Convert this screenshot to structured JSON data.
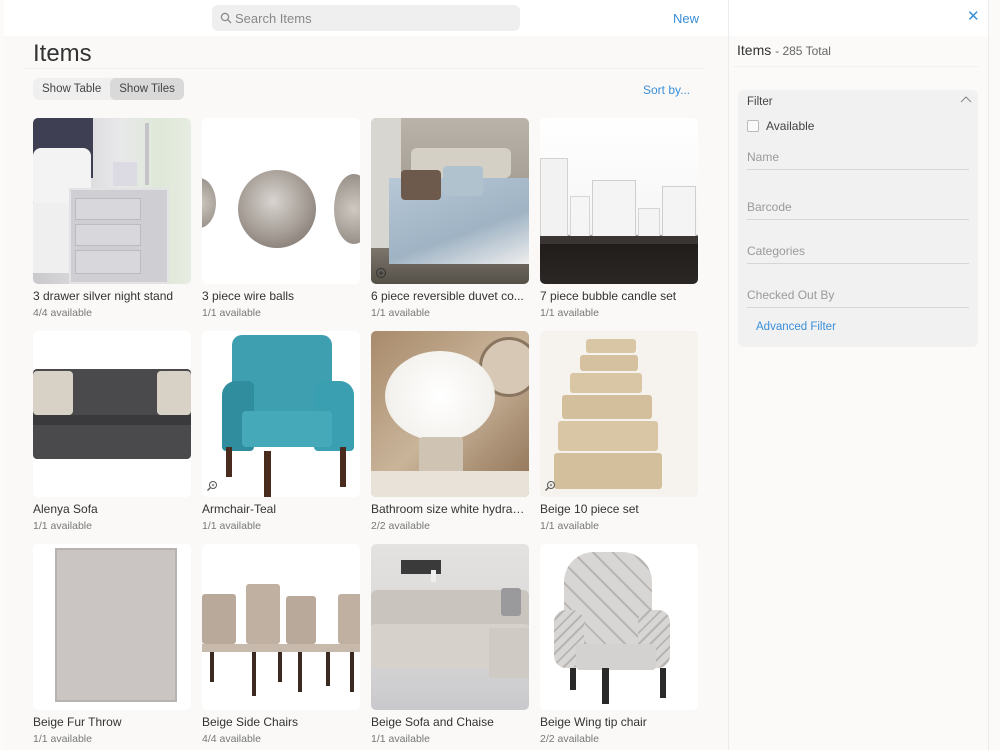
{
  "header": {
    "search_placeholder": "Search Items",
    "new_label": "New"
  },
  "main": {
    "title": "Items",
    "view_toggle": [
      {
        "label": "Show Table",
        "active": false
      },
      {
        "label": "Show Tiles",
        "active": true
      }
    ],
    "sort_label": "Sort by...",
    "items": [
      {
        "name": "3 drawer silver night stand",
        "availability": "4/4 available",
        "icon": "nightstand-photo",
        "zoom_icon": false
      },
      {
        "name": "3 piece wire balls",
        "availability": "1/1 available",
        "icon": "wire-balls-photo",
        "zoom_icon": false
      },
      {
        "name": "6 piece reversible duvet co...",
        "availability": "1/1 available",
        "icon": "duvet-photo",
        "zoom_icon": true
      },
      {
        "name": "7 piece bubble candle set",
        "availability": "1/1 available",
        "icon": "candle-set-photo",
        "zoom_icon": false
      },
      {
        "name": "Alenya Sofa",
        "availability": "1/1 available",
        "icon": "sofa-photo",
        "zoom_icon": false
      },
      {
        "name": "Armchair-Teal",
        "availability": "1/1 available",
        "icon": "armchair-photo",
        "zoom_icon": true
      },
      {
        "name": "Bathroom size white hydran...",
        "availability": "2/2 available",
        "icon": "hydrangea-photo",
        "zoom_icon": false
      },
      {
        "name": "Beige 10 piece set",
        "availability": "1/1 available",
        "icon": "towel-set-photo",
        "zoom_icon": true
      },
      {
        "name": "Beige Fur Throw",
        "availability": "1/1 available",
        "icon": "fur-throw-photo",
        "zoom_icon": false
      },
      {
        "name": "Beige Side Chairs",
        "availability": "4/4 available",
        "icon": "side-chairs-photo",
        "zoom_icon": false
      },
      {
        "name": "Beige Sofa and Chaise",
        "availability": "1/1 available",
        "icon": "sofa-chaise-photo",
        "zoom_icon": false
      },
      {
        "name": "Beige Wing tip chair",
        "availability": "2/2 available",
        "icon": "wing-chair-photo",
        "zoom_icon": false
      }
    ]
  },
  "panel": {
    "title": "Items",
    "total": "- 285 Total",
    "filter": {
      "heading": "Filter",
      "available_label": "Available",
      "available_checked": false,
      "fields": [
        {
          "placeholder": "Name",
          "value": ""
        },
        {
          "placeholder": "Barcode",
          "value": ""
        },
        {
          "placeholder": "Categories",
          "value": ""
        },
        {
          "placeholder": "Checked Out By",
          "value": ""
        }
      ],
      "advanced_label": "Advanced Filter"
    }
  },
  "colors": {
    "accent": "#3a8fd8",
    "background": "#faf9f8",
    "card": "#f1f1f2"
  }
}
